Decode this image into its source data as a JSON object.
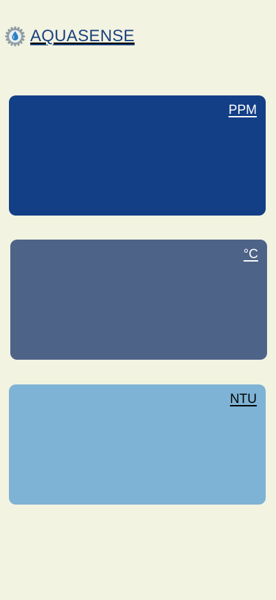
{
  "brand": {
    "name": "AQUASENSE",
    "logo_icon": "water-drop-gear-icon"
  },
  "cards": [
    {
      "id": "tds",
      "unit": "PPM",
      "color": "#133f86",
      "text_color": "#ffffff"
    },
    {
      "id": "temperature",
      "unit": "°C",
      "color": "#4e6388",
      "text_color": "#ffffff"
    },
    {
      "id": "turbidity",
      "unit": "NTU",
      "color": "#7eb3d5",
      "text_color": "#000000"
    }
  ],
  "colors": {
    "background": "#f3f3e1",
    "brand": "#1a4280"
  }
}
